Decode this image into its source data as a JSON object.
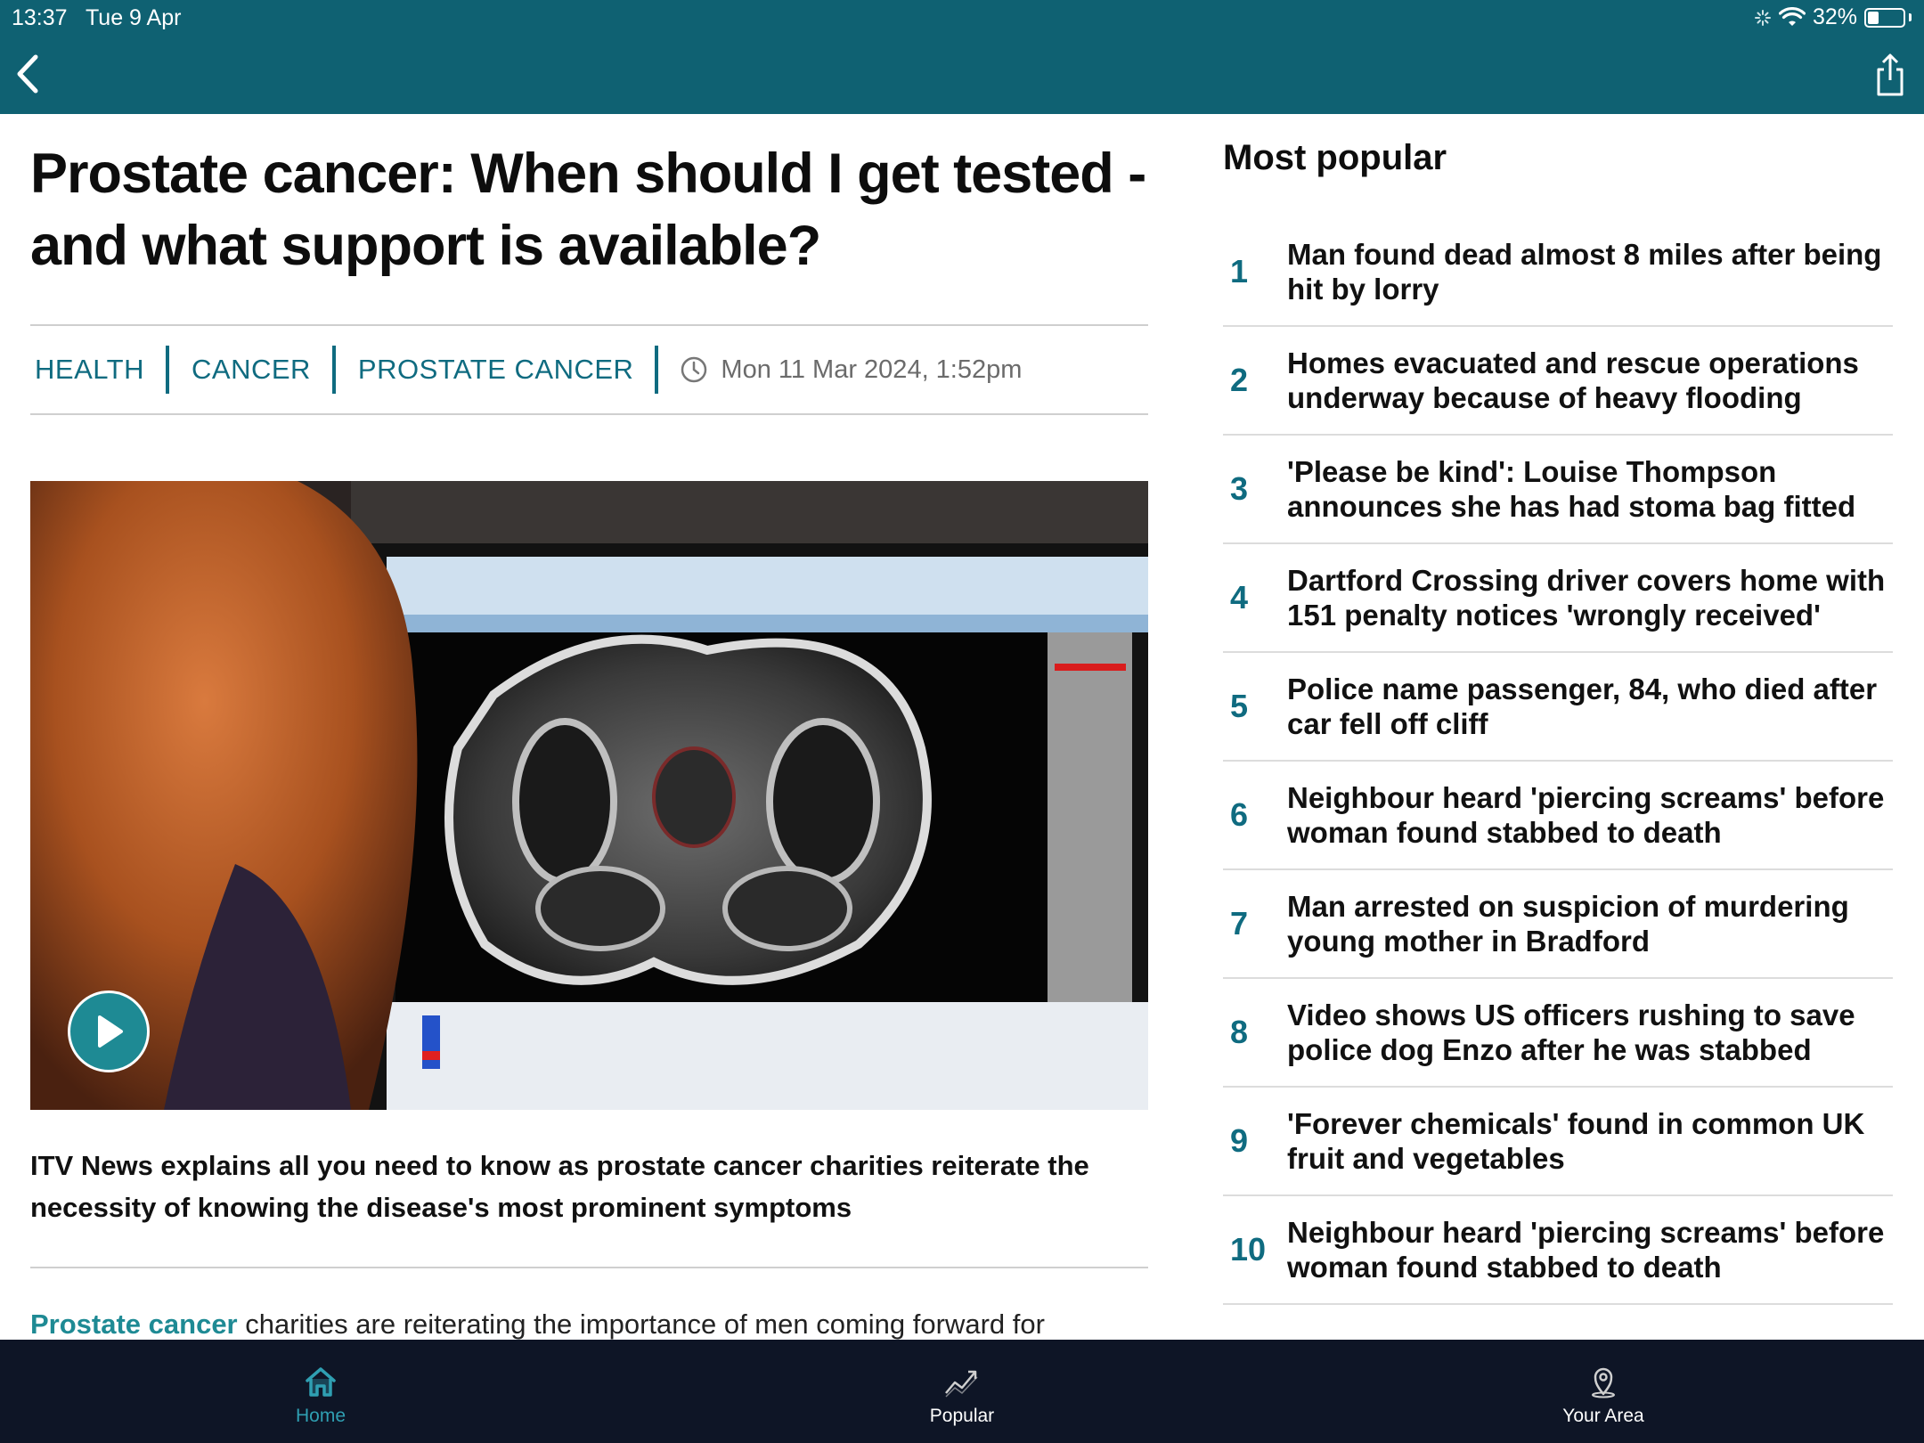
{
  "status_bar": {
    "time": "13:37",
    "date": "Tue 9 Apr",
    "battery": "32%",
    "battery_level": 0.32
  },
  "colors": {
    "header": "#0f6172",
    "accent": "#1e8a94",
    "tag": "#0f6b80",
    "tabbar": "#0e1526",
    "tab_active": "#2f9fb2"
  },
  "nav": {
    "back_icon": "chevron-left-icon",
    "share_icon": "share-icon"
  },
  "article": {
    "headline": "Prostate cancer: When should I get tested - and what support is available?",
    "tags": [
      "HEALTH",
      "CANCER",
      "PROSTATE CANCER"
    ],
    "date": "Mon 11 Mar 2024, 1:52pm",
    "standfirst": "ITV News explains all you need to know as prostate cancer charities reiterate the necessity of knowing the disease's most prominent symptoms",
    "body_link": "Prostate cancer",
    "body_text": " charities are reiterating the importance of men coming forward for"
  },
  "most_popular": {
    "title": "Most popular",
    "items": [
      {
        "rank": "1",
        "title": "Man found dead almost 8 miles after being hit by lorry"
      },
      {
        "rank": "2",
        "title": "Homes evacuated and rescue operations underway because of heavy flooding"
      },
      {
        "rank": "3",
        "title": "'Please be kind': Louise Thompson announces she has had stoma bag fitted"
      },
      {
        "rank": "4",
        "title": "Dartford Crossing driver covers home with 151 penalty notices 'wrongly received'"
      },
      {
        "rank": "5",
        "title": "Police name passenger, 84, who died after car fell off cliff"
      },
      {
        "rank": "6",
        "title": "Neighbour heard 'piercing screams' before woman found stabbed to death"
      },
      {
        "rank": "7",
        "title": "Man arrested on suspicion of murdering young mother in Bradford"
      },
      {
        "rank": "8",
        "title": "Video shows US officers rushing to save police dog Enzo after he was stabbed"
      },
      {
        "rank": "9",
        "title": "'Forever chemicals' found in common UK fruit and vegetables"
      },
      {
        "rank": "10",
        "title": "Neighbour heard 'piercing screams' before woman found stabbed to death"
      }
    ]
  },
  "tabbar": {
    "items": [
      {
        "label": "Home",
        "icon": "home-icon",
        "active": true
      },
      {
        "label": "Popular",
        "icon": "trending-icon",
        "active": false
      },
      {
        "label": "Your Area",
        "icon": "location-pin-icon",
        "active": false
      }
    ]
  }
}
